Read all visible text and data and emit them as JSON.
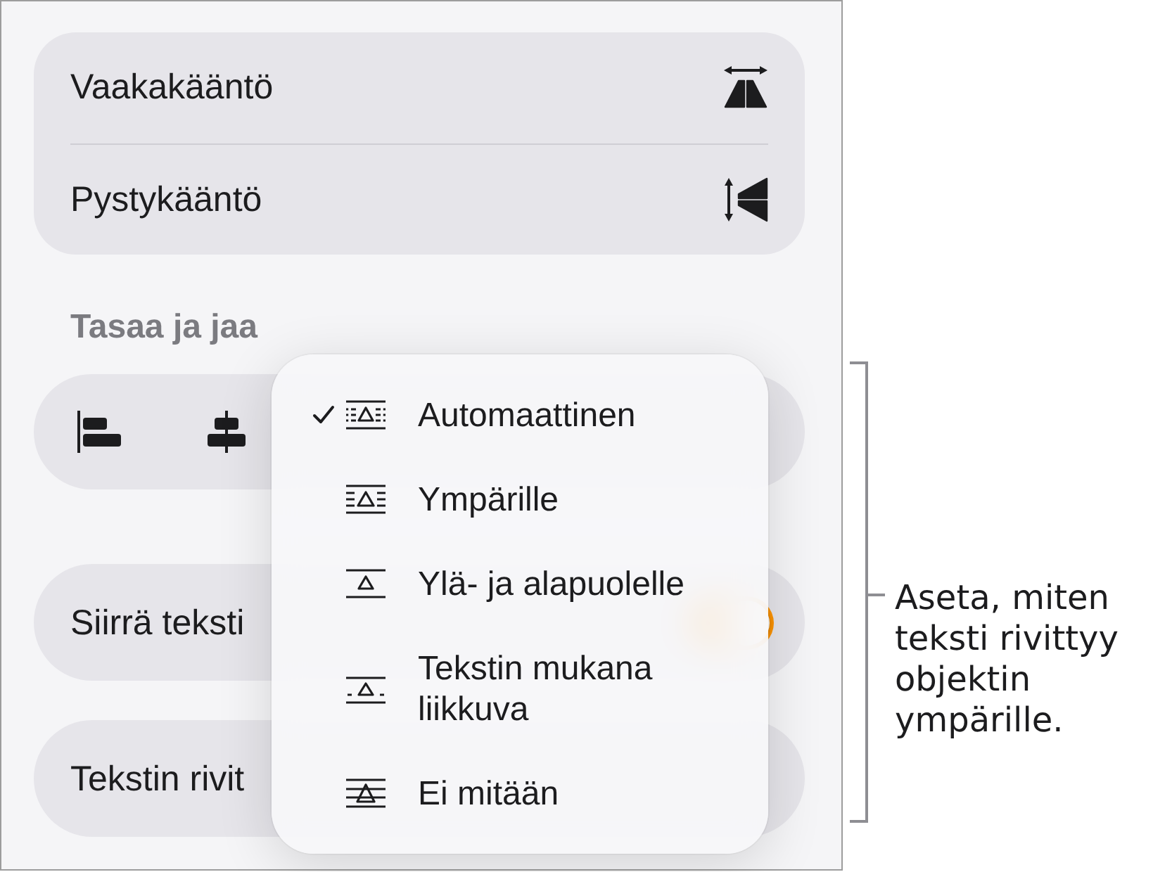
{
  "flip_options": [
    {
      "label": "Vaakakääntö",
      "kind": "horizontal"
    },
    {
      "label": "Pystykääntö",
      "kind": "vertical"
    }
  ],
  "align_section": {
    "heading": "Tasaa ja jaa"
  },
  "option_rows": [
    {
      "label": "Siirrä teksti",
      "toggle": {
        "on": true
      }
    },
    {
      "label": "Tekstin rivit"
    }
  ],
  "wrap_menu": {
    "items": [
      {
        "label": "Automaattinen",
        "kind": "automatic",
        "selected": true
      },
      {
        "label": "Ympärille",
        "kind": "around",
        "selected": false
      },
      {
        "label": "Ylä- ja alapuolelle",
        "kind": "above_below",
        "selected": false
      },
      {
        "label": "Tekstin mukana liikkuva",
        "kind": "inline",
        "selected": false
      },
      {
        "label": "Ei mitään",
        "kind": "none",
        "selected": false
      }
    ]
  },
  "callout": {
    "text": "Aseta, miten teksti rivittyy objektin ympärille."
  }
}
